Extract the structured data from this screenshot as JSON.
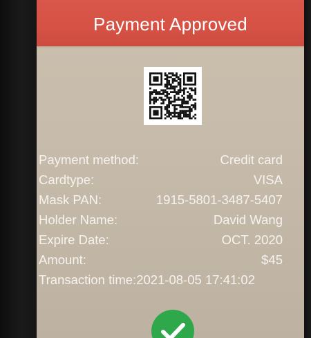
{
  "header": {
    "title": "Payment Approved",
    "color": "#d9564a"
  },
  "qr": {
    "icon": "qr-code"
  },
  "details": {
    "payment_method": {
      "label": "Payment method:",
      "value": "Credit card"
    },
    "cardtype": {
      "label": "Cardtype:",
      "value": "VISA"
    },
    "mask_pan": {
      "label": "Mask PAN:",
      "value": "1915-5801-3487-5407"
    },
    "holder_name": {
      "label": "Holder Name:",
      "value": "David Wang"
    },
    "expire_date": {
      "label": "Expire Date:",
      "value": "OCT. 2020"
    },
    "amount": {
      "label": "Amount:",
      "value": "$45"
    },
    "transaction_time": {
      "label": "Transaction time:",
      "value": "2021-08-05 17:41:02"
    }
  },
  "confirm": {
    "icon": "check-icon",
    "color": "#2ea84a"
  }
}
